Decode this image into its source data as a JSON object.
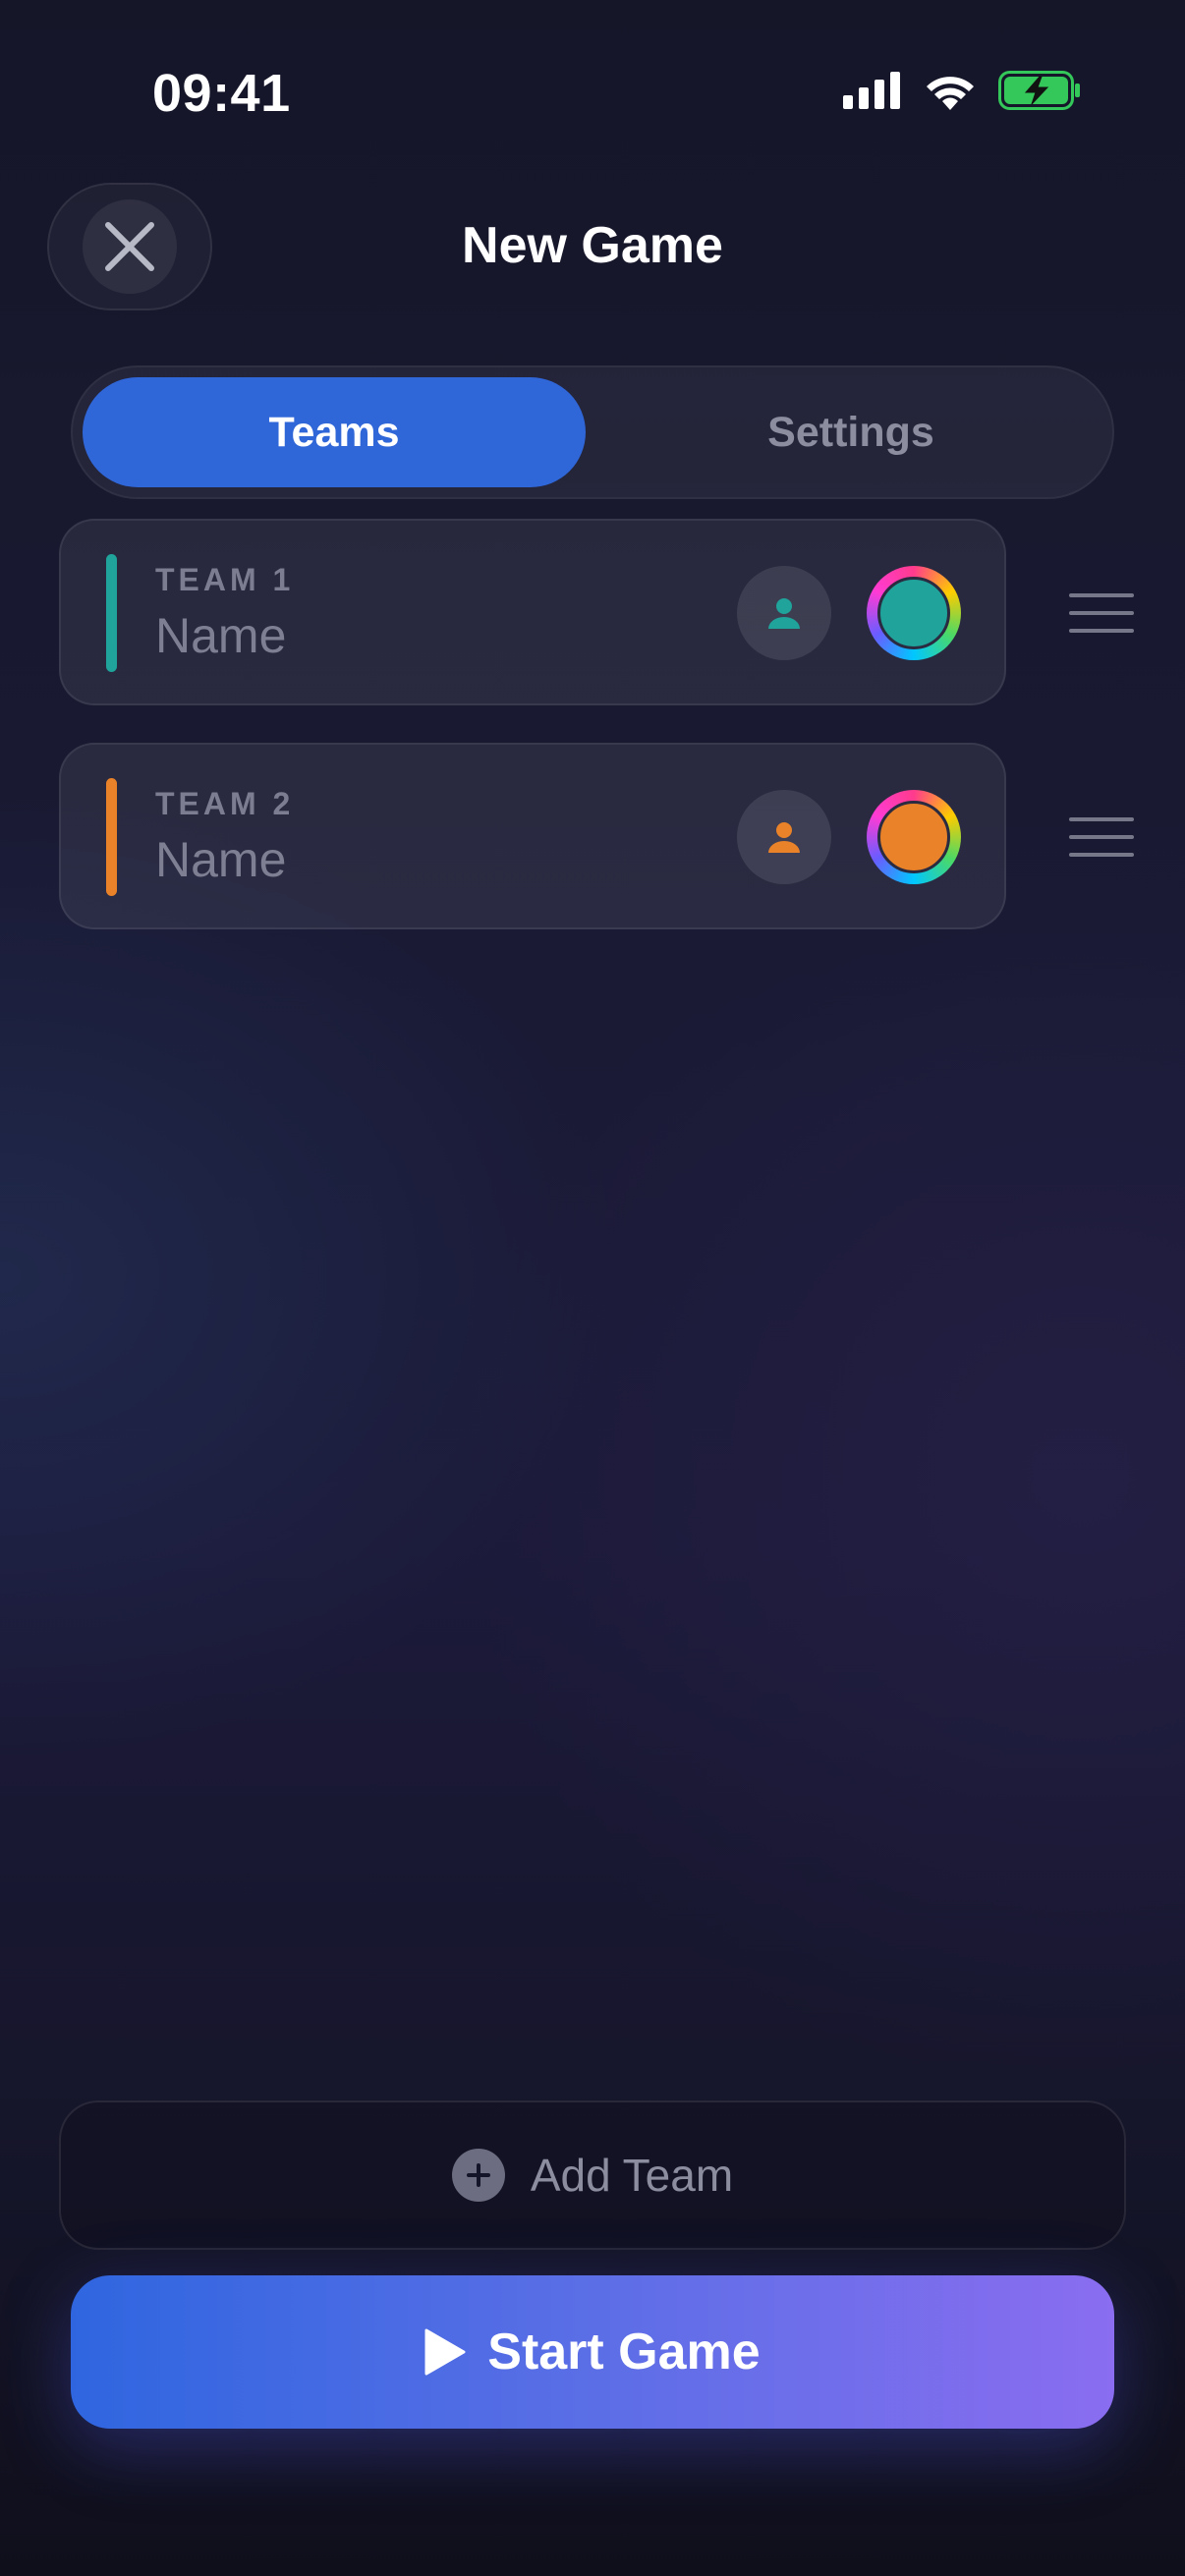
{
  "status_bar": {
    "time": "09:41",
    "icons": [
      "cellular-signal-icon",
      "wifi-icon",
      "battery-charging-icon"
    ]
  },
  "header": {
    "title": "New Game",
    "close_icon": "close-icon"
  },
  "tabs": [
    {
      "label": "Teams",
      "active": true
    },
    {
      "label": "Settings",
      "active": false
    }
  ],
  "teams": [
    {
      "label": "TEAM 1",
      "name_placeholder": "Name",
      "color": "#1fa39b"
    },
    {
      "label": "TEAM 2",
      "name_placeholder": "Name",
      "color": "#e98228"
    }
  ],
  "actions": {
    "add_team_label": "Add Team",
    "start_game_label": "Start Game"
  },
  "colors": {
    "accent_blue": "#2f66d8",
    "start_gradient_end": "#8a6df0",
    "battery_green": "#34c759"
  }
}
